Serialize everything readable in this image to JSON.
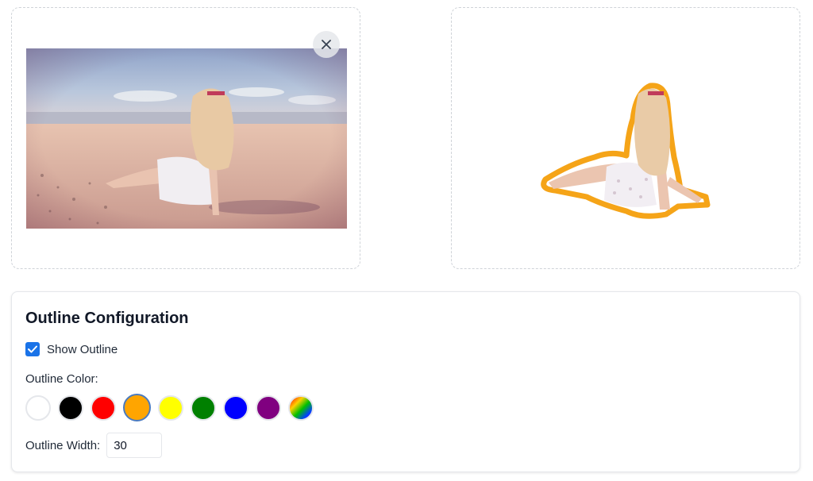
{
  "upload_panel": {
    "close_icon": "close-icon"
  },
  "config": {
    "title": "Outline Configuration",
    "show_outline_label": "Show Outline",
    "show_outline_checked": true,
    "color_label": "Outline Color:",
    "colors": [
      "#ffffff",
      "#000000",
      "#ff0000",
      "#ffa500",
      "#ffff00",
      "#008000",
      "#0000ff",
      "#800080",
      "rainbow-gradient"
    ],
    "selected_color": "#ffa500",
    "width_label": "Outline Width:",
    "width_value": "30"
  }
}
